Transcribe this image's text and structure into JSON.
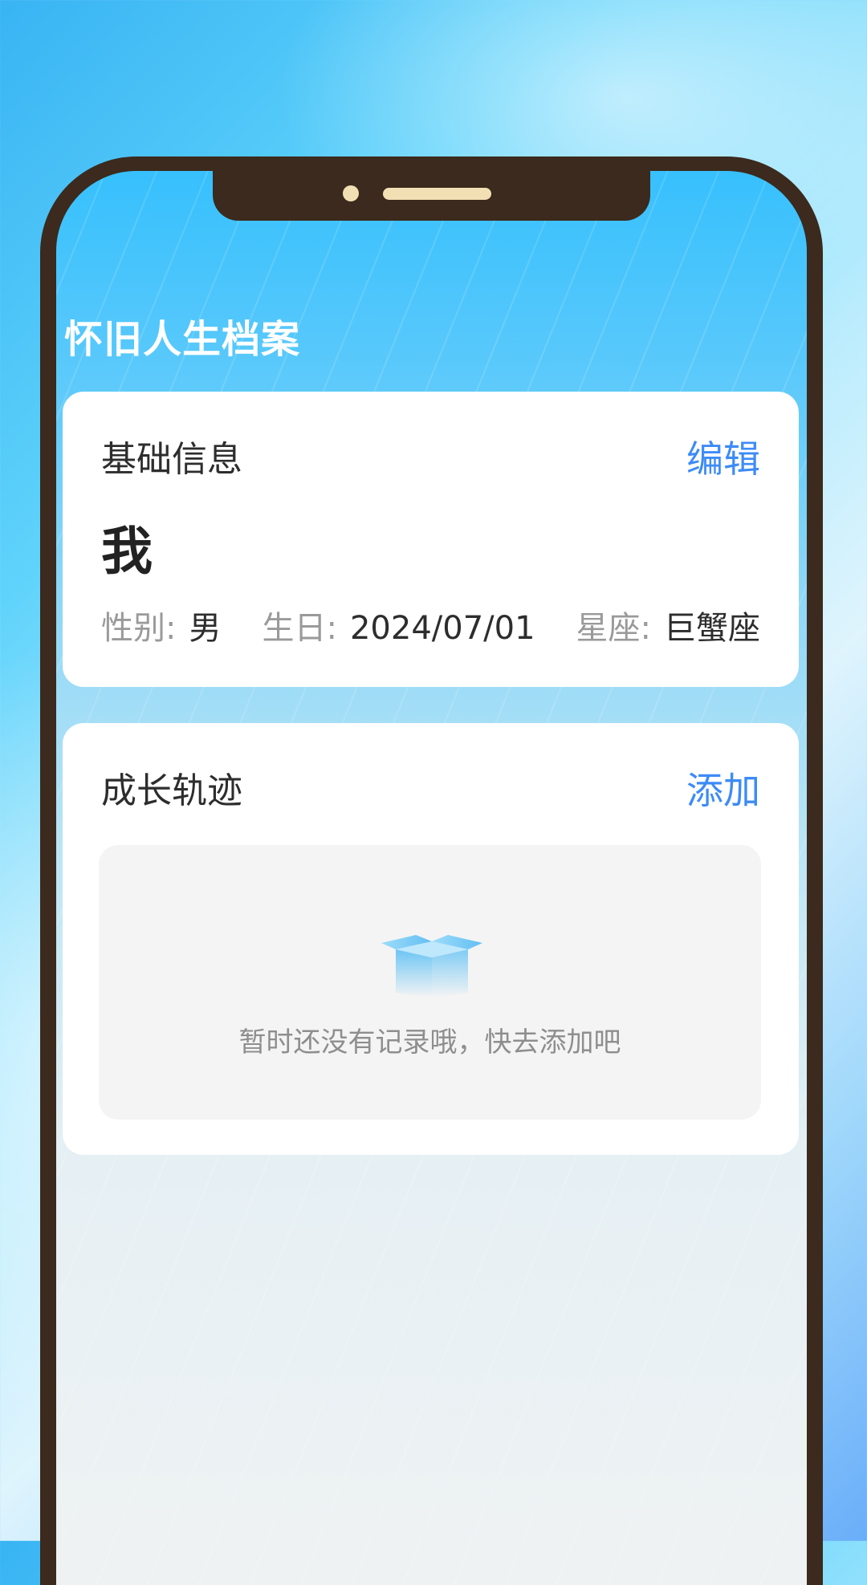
{
  "app": {
    "title": "怀旧人生档案"
  },
  "basic_info": {
    "title": "基础信息",
    "edit_label": "编辑",
    "name": "我",
    "gender_label": "性别:",
    "gender_value": "男",
    "birthday_label": "生日:",
    "birthday_value": "2024/07/01",
    "zodiac_label": "星座:",
    "zodiac_value": "巨蟹座"
  },
  "growth": {
    "title": "成长轨迹",
    "add_label": "添加",
    "empty_icon": "empty-box-icon",
    "empty_text": "暂时还没有记录哦，快去添加吧"
  },
  "colors": {
    "accent": "#3d8bf7",
    "phone_frame": "#3b2a1d",
    "sky_top": "#37c0fd"
  }
}
